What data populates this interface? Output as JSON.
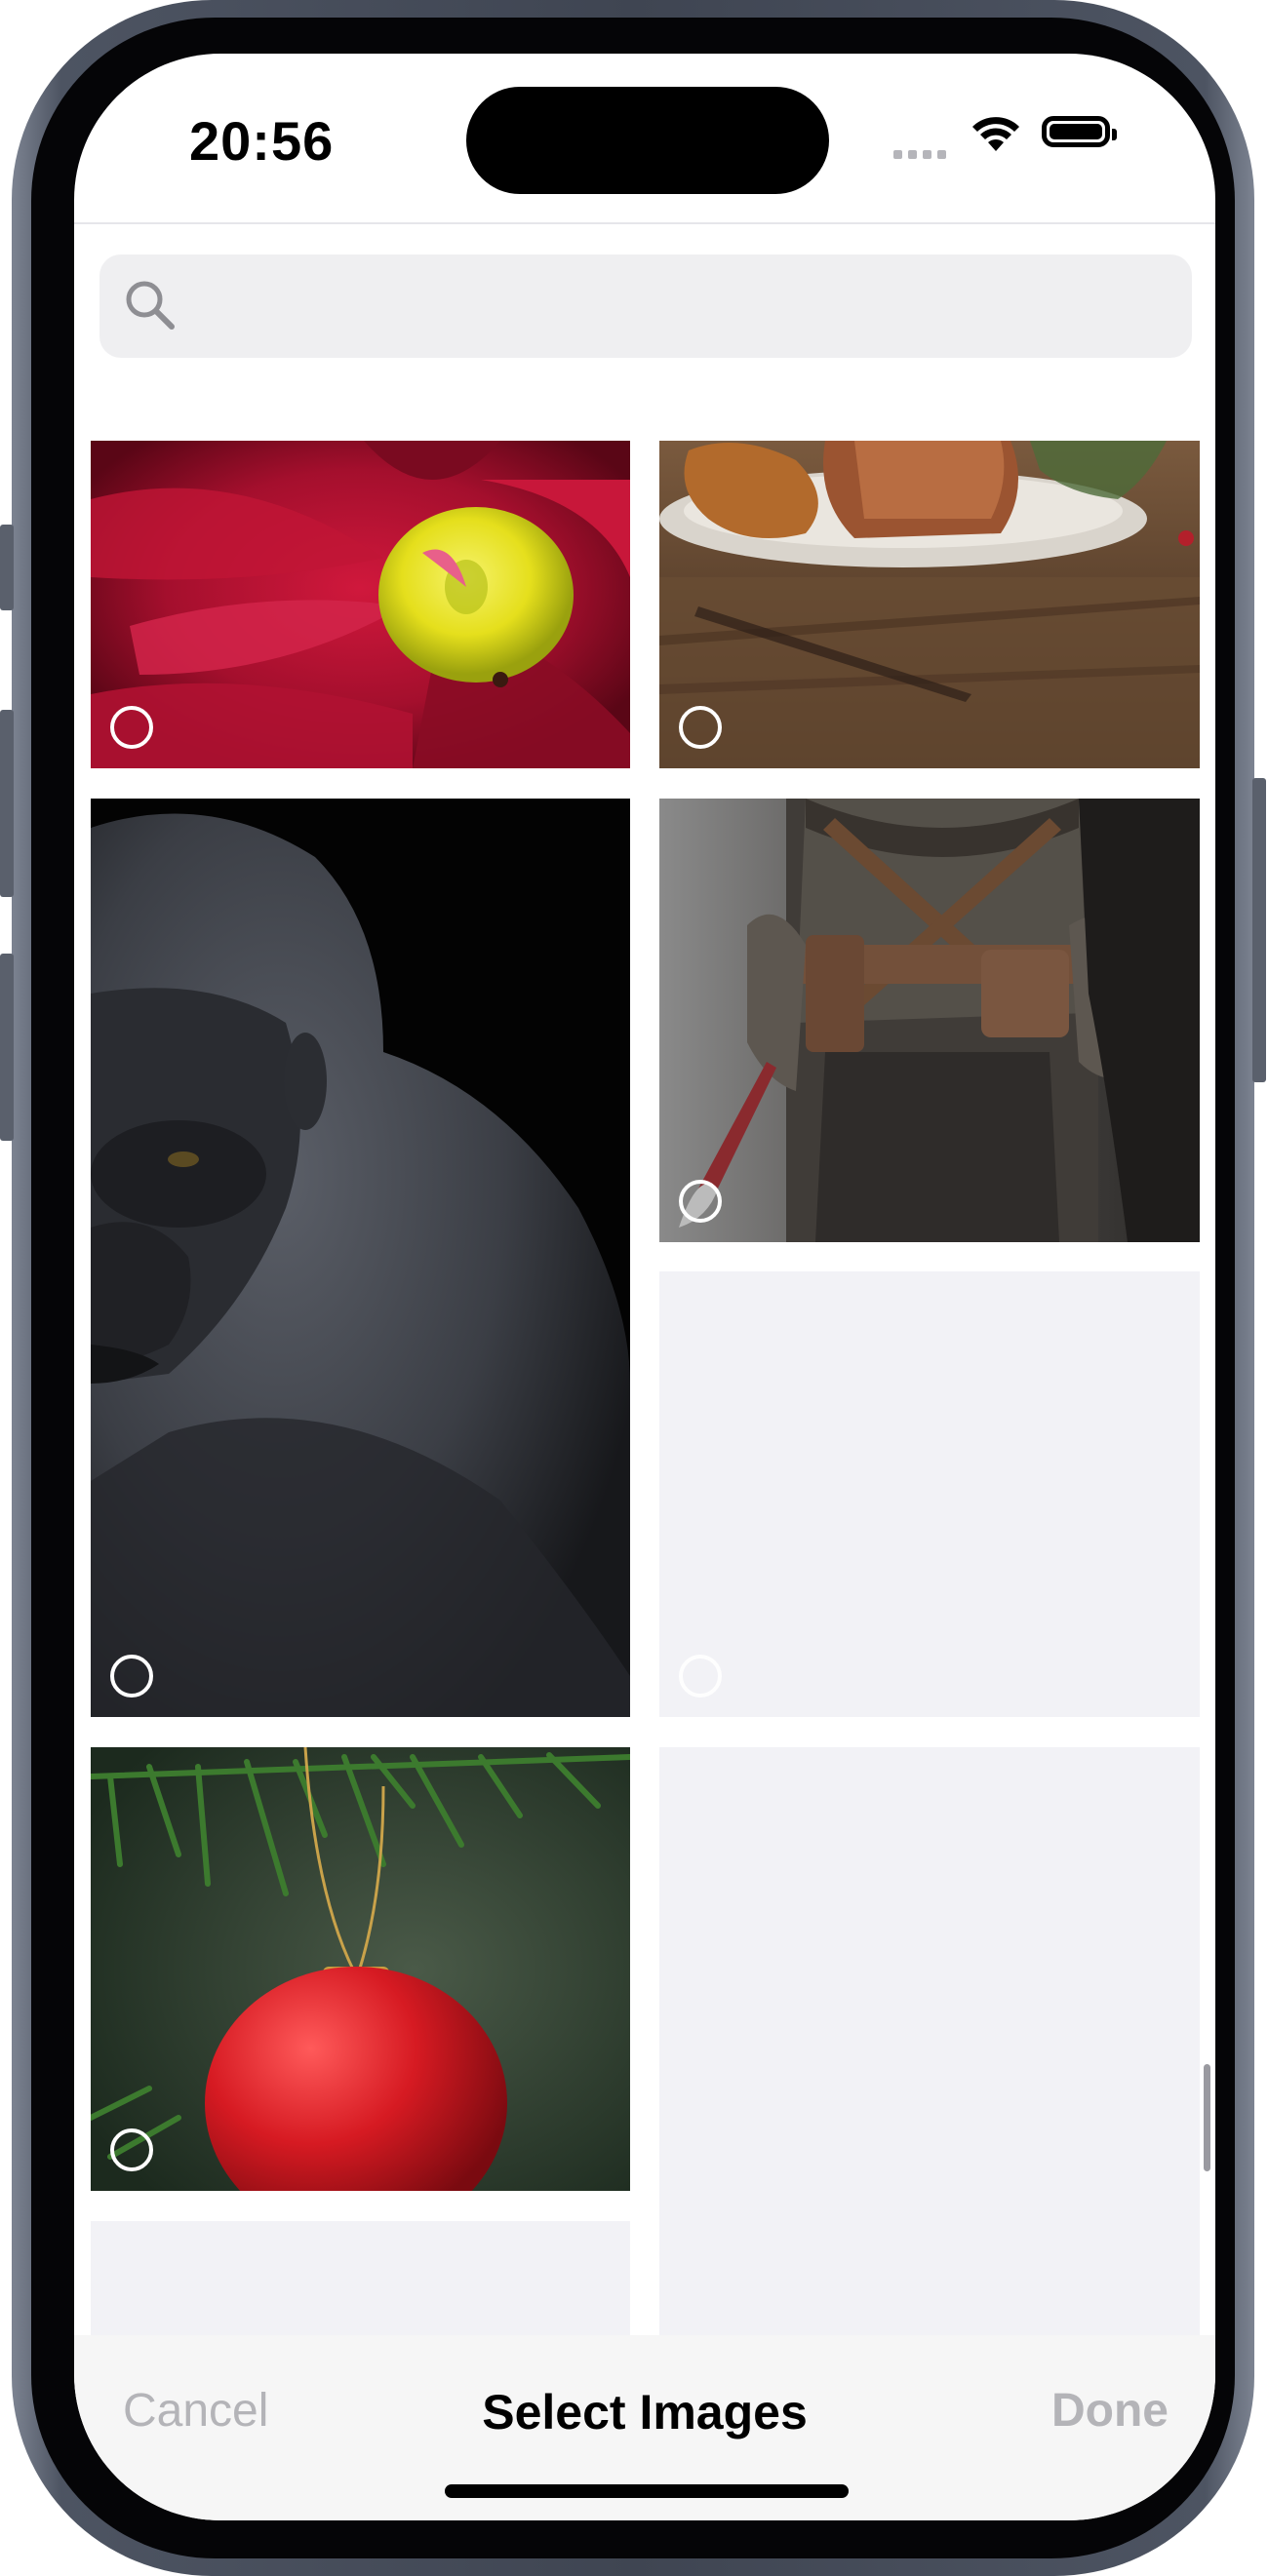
{
  "status_bar": {
    "time": "20:56"
  },
  "search": {
    "placeholder": "",
    "value": "",
    "icon": "magnifying-glass"
  },
  "grid": {
    "tiles": [
      {
        "id": "flower",
        "content": "red-flower-photo",
        "selected": false
      },
      {
        "id": "roast",
        "content": "roast-on-plate-photo",
        "selected": false
      },
      {
        "id": "gorilla",
        "content": "gorilla-photo",
        "selected": false
      },
      {
        "id": "warrior",
        "content": "armored-warrior-photo",
        "selected": false
      },
      {
        "id": "placeholder-1",
        "content": "loading-placeholder",
        "selected": false
      },
      {
        "id": "ornament",
        "content": "christmas-ornament-photo",
        "selected": false
      },
      {
        "id": "placeholder-2",
        "content": "loading-placeholder",
        "selected": false
      },
      {
        "id": "placeholder-3",
        "content": "loading-placeholder",
        "selected": false
      }
    ]
  },
  "toolbar": {
    "cancel_label": "Cancel",
    "title": "Select Images",
    "done_label": "Done"
  },
  "colors": {
    "disabled_text": "#b4b4b8",
    "placeholder_tile": "#f2f2f6",
    "search_bg": "#efeff1"
  }
}
